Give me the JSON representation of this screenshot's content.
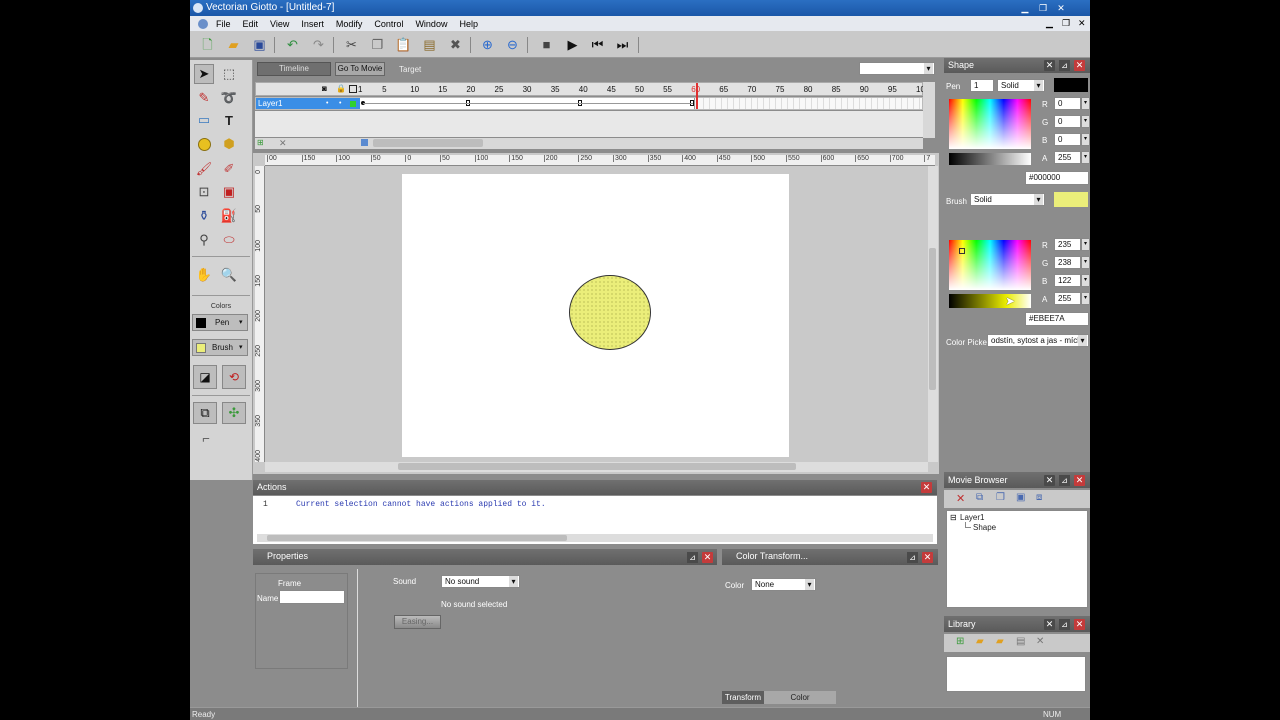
{
  "window": {
    "title": "Vectorian Giotto - [Untitled-7]"
  },
  "menu": [
    "File",
    "Edit",
    "View",
    "Insert",
    "Modify",
    "Control",
    "Window",
    "Help"
  ],
  "timeline": {
    "tab_timeline": "Timeline",
    "go_to_movie": "Go To Movie",
    "target": "Target",
    "layer_name": "Layer1",
    "frame_numbers": [
      "1",
      "5",
      "10",
      "15",
      "20",
      "25",
      "30",
      "35",
      "40",
      "45",
      "50",
      "55",
      "60",
      "65",
      "70",
      "75",
      "80",
      "85",
      "90",
      "95",
      "10"
    ]
  },
  "ruler": {
    "top": [
      "00",
      "150",
      "100",
      "50",
      "0",
      "50",
      "100",
      "150",
      "200",
      "250",
      "300",
      "350",
      "400",
      "450",
      "500",
      "550",
      "600",
      "650",
      "700",
      "7"
    ],
    "left": [
      "0",
      "50",
      "100",
      "150",
      "200",
      "250",
      "300",
      "350",
      "400"
    ]
  },
  "tools": {
    "colors_label": "Colors",
    "pen_label": "Pen",
    "brush_label": "Brush"
  },
  "shape_panel": {
    "title": "Shape",
    "pen_label": "Pen",
    "pen_width": "1",
    "pen_style": "Solid",
    "pen_r_label": "R",
    "pen_g_label": "G",
    "pen_b_label": "B",
    "pen_a_label": "A",
    "pen_r": "0",
    "pen_g": "0",
    "pen_b": "0",
    "pen_a": "255",
    "pen_hex": "#000000",
    "brush_label": "Brush",
    "brush_style": "Solid",
    "brush_r": "235",
    "brush_g": "238",
    "brush_b": "122",
    "brush_a": "255",
    "brush_hex": "#EBEE7A",
    "color_picker_label": "Color Picker",
    "color_picker_value": "odstín, sytost a jas - míchá"
  },
  "movie_browser": {
    "title": "Movie Browser",
    "layer": "Layer1",
    "shape": "Shape"
  },
  "library": {
    "title": "Library"
  },
  "actions": {
    "title": "Actions",
    "line_no": "1",
    "message": "Current selection cannot have actions applied to it."
  },
  "properties": {
    "title": "Properties",
    "frame_label": "Frame",
    "name_label": "Name",
    "name_value": "",
    "sound_label": "Sound",
    "sound_value": "No sound",
    "no_sound_selected": "No sound selected",
    "easing": "Easing..."
  },
  "color_transform": {
    "title": "Color Transform...",
    "color_label": "Color",
    "color_value": "None",
    "tab_transform": "Transform",
    "tab_color_transformation": "Color Transformation"
  },
  "status": {
    "left": "Ready",
    "right": "NUM"
  },
  "colors": {
    "pen": "#000000",
    "brush": "#EBEE7A",
    "accent": "#3a8ee6",
    "close": "#c43b3b"
  }
}
